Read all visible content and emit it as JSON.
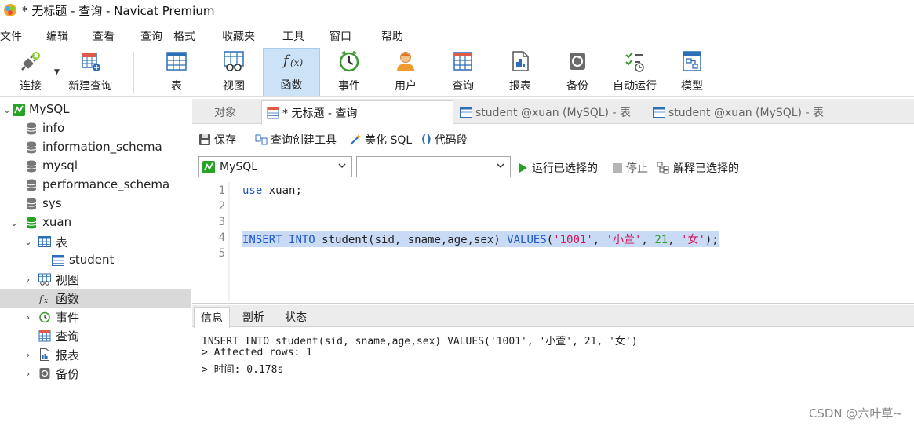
{
  "window": {
    "title": "* 无标题 - 查询 - Navicat Premium"
  },
  "menu": [
    "文件",
    "编辑",
    "查看",
    "查询",
    "格式",
    "收藏夹",
    "工具",
    "窗口",
    "帮助"
  ],
  "toolbar": {
    "connect": "连接",
    "new_query": "新建查询",
    "table": "表",
    "view": "视图",
    "function": "函数",
    "event": "事件",
    "user": "用户",
    "query": "查询",
    "report": "报表",
    "backup": "备份",
    "automation": "自动运行",
    "model": "模型"
  },
  "tree": {
    "mysql_conn": "MySQL",
    "db_info": "info",
    "db_information_schema": "information_schema",
    "db_mysql": "mysql",
    "db_performance_schema": "performance_schema",
    "db_sys": "sys",
    "db_xuan": "xuan",
    "tables": "表",
    "table_student": "student",
    "views": "视图",
    "functions": "函数",
    "events": "事件",
    "queries": "查询",
    "reports": "报表",
    "backups": "备份"
  },
  "tabs": {
    "objects": "对象",
    "query_tab": "* 无标题 - 查询",
    "table_tab_1": "student @xuan (MySQL) - 表",
    "table_tab_2": "student @xuan (MySQL) - 表"
  },
  "query_toolbar": {
    "save": "保存",
    "query_builder": "查询创建工具",
    "beautify": "美化 SQL",
    "snippet": "代码段"
  },
  "selectors": {
    "connection": "MySQL",
    "database": "",
    "run_selected": "运行已选择的",
    "stop": "停止",
    "explain_selected": "解释已选择的"
  },
  "editor": {
    "line_numbers": [
      "1",
      "2",
      "3",
      "4",
      "5"
    ],
    "line1_kw": "use",
    "line1_rest": " xuan;",
    "line4": {
      "kw1": "INSERT",
      "sp1": " ",
      "kw2": "INTO",
      "mid": " student(sid, sname,age,sex) ",
      "kw3": "VALUES",
      "p1": "(",
      "s1": "'1001'",
      "c1": ", ",
      "s2": "'小萱'",
      "c2": ", ",
      "n1": "21",
      "c3": ", ",
      "s3": "'女'",
      "end": ");"
    }
  },
  "result": {
    "tabs": [
      "信息",
      "剖析",
      "状态"
    ],
    "lines": [
      "INSERT INTO student(sid, sname,age,sex) VALUES('1001', '小萱', 21, '女')",
      "> Affected rows: 1",
      "> 时间: 0.178s"
    ]
  },
  "watermark": "CSDN @六叶草~",
  "colors": {
    "keyword": "#1f58c8",
    "string": "#d0145a",
    "number": "#2e9e2e",
    "selection": "#c8daf4",
    "active_tool": "#cce3f7"
  }
}
